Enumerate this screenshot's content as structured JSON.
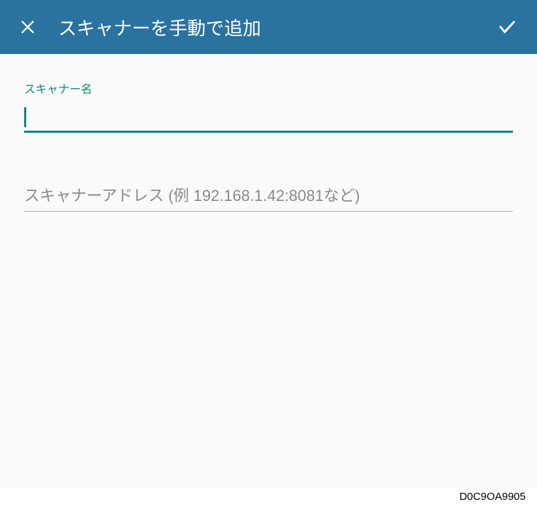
{
  "header": {
    "title": "スキャナーを手動で追加"
  },
  "form": {
    "name": {
      "label": "スキャナー名",
      "value": ""
    },
    "address": {
      "placeholder": "スキャナーアドレス (例 192.168.1.42:8081など)",
      "value": ""
    }
  },
  "footer": {
    "id": "D0C9OA9905"
  },
  "colors": {
    "header_bg": "#2a72a0",
    "accent": "#0e8a7a"
  }
}
